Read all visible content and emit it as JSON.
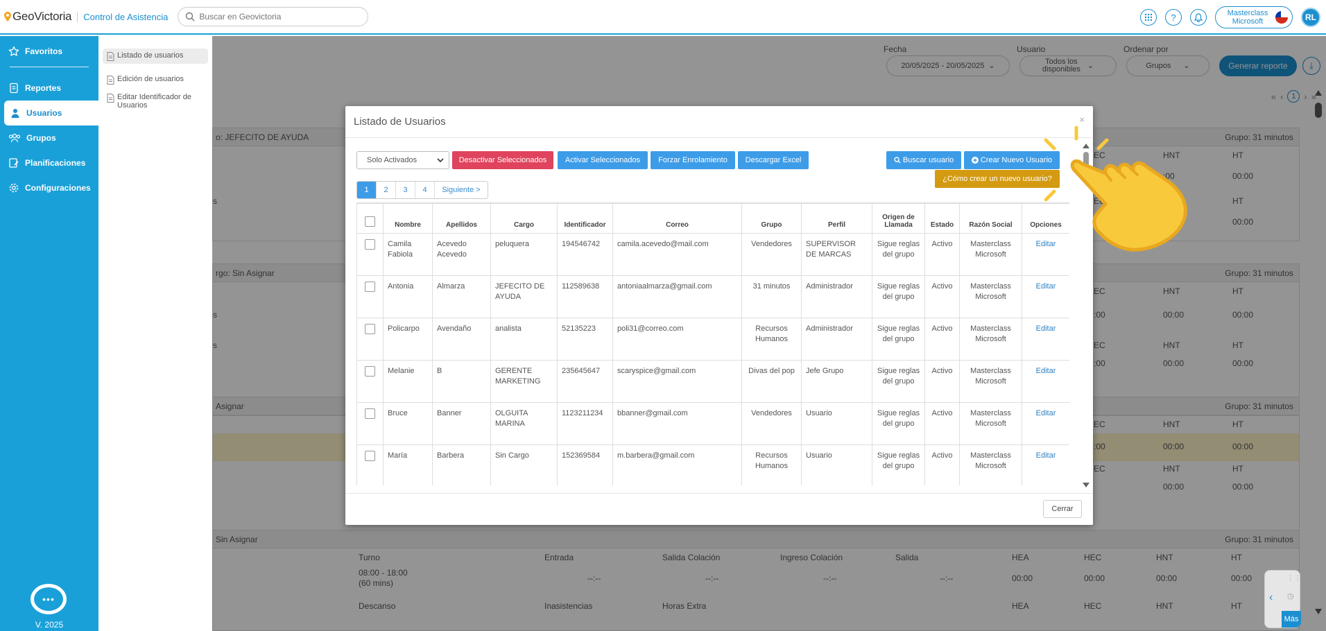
{
  "header": {
    "logo_text": "GeoVictoria",
    "app_name": "Control de Asistencia",
    "search_placeholder": "Buscar en Geovictoria",
    "company_line1": "Masterclass",
    "company_line2": "Microsoft",
    "avatar_initials": "RL"
  },
  "sidebar": {
    "items": [
      {
        "label": "Favoritos",
        "icon": "star-icon"
      },
      {
        "label": "Reportes",
        "icon": "report-icon"
      },
      {
        "label": "Usuarios",
        "icon": "user-icon"
      },
      {
        "label": "Grupos",
        "icon": "group-icon"
      },
      {
        "label": "Planificaciones",
        "icon": "plan-icon"
      },
      {
        "label": "Configuraciones",
        "icon": "gear-icon"
      }
    ],
    "active": "Usuarios",
    "version": "V. 2025"
  },
  "submenu": {
    "items": [
      "Listado de usuarios",
      "Edición de usuarios",
      "Editar Identificador de Usuarios"
    ]
  },
  "background": {
    "filters": {
      "fecha_label": "Fecha",
      "fecha_value": "20/05/2025 - 20/05/2025",
      "usuario_label": "Usuario",
      "usuario_value_line1": "Todos los",
      "usuario_value_line2": "disponibles",
      "ordenar_label": "Ordenar por",
      "ordenar_value": "Grupos",
      "generate_button": "Generar reporte"
    },
    "pager_current": "1",
    "sections": [
      {
        "title": "o: JEFECITO DE AYUDA",
        "group": "Grupo: 31 minutos"
      },
      {
        "title": "rgo: Sin Asignar",
        "group": "Grupo: 31 minutos"
      },
      {
        "title": "Asignar",
        "group": "Grupo: 31 minutos"
      },
      {
        "title": "Sin Asignar",
        "group": "Grupo: 31 minutos"
      }
    ],
    "col_heads": {
      "hea": "HEA",
      "hec": "HEC",
      "hnt": "HNT",
      "ht": "HT",
      "hec_cut": "EC",
      "turno": "Turno",
      "entrada": "Entrada",
      "salida_colacion": "Salida Colación",
      "ingreso_colacion": "Ingreso Colación",
      "salida": "Salida",
      "descanso": "Descanso",
      "inasistencias": "Inasistencias",
      "horas_extra": "Horas Extra"
    },
    "zero": "00:00",
    "zero_cut": ":00",
    "dash": "--:--",
    "s_cut": "s",
    "turno_value_line1": "08:00 - 18:00",
    "turno_value_line2": "(60 mins)",
    "widget_label": "Más"
  },
  "modal": {
    "title": "Listado de Usuarios",
    "close": "×",
    "filter_select": "Solo Activados",
    "buttons": {
      "deactivate": "Desactivar Seleccionados",
      "activate": "Activar Seleccionados",
      "force_enroll": "Forzar Enrolamiento",
      "download_excel": "Descargar Excel",
      "search_user": "Buscar usuario",
      "create_user": "Crear Nuevo Usuario",
      "how_to_create": "¿Cómo crear un nuevo usuario?",
      "close": "Cerrar"
    },
    "pagination": [
      "1",
      "2",
      "3",
      "4",
      "Siguiente >"
    ],
    "columns": [
      "Nombre",
      "Apellidos",
      "Cargo",
      "Identificador",
      "Correo",
      "Grupo",
      "Perfil",
      "Origen de Llamada",
      "Estado",
      "Razón Social",
      "Opciones"
    ],
    "rows": [
      {
        "nombre": "Camila Fabiola",
        "apellidos": "Acevedo Acevedo",
        "cargo": "peluquera",
        "id": "194546742",
        "correo": "camila.acevedo@mail.com",
        "grupo": "Vendedores",
        "perfil": "SUPERVISOR DE MARCAS",
        "origen": "Sigue reglas del grupo",
        "estado": "Activo",
        "razon": "Masterclass Microsoft",
        "opcion": "Editar"
      },
      {
        "nombre": "Antonia",
        "apellidos": "Almarza",
        "cargo": "JEFECITO DE AYUDA",
        "id": "112589638",
        "correo": "antoniaalmarza@gmail.com",
        "grupo": "31 minutos",
        "perfil": "Administrador",
        "origen": "Sigue reglas del grupo",
        "estado": "Activo",
        "razon": "Masterclass Microsoft",
        "opcion": "Editar"
      },
      {
        "nombre": "Policarpo",
        "apellidos": "Avendaño",
        "cargo": "analista",
        "id": "52135223",
        "correo": "poli31@correo.com",
        "grupo": "Recursos Humanos",
        "perfil": "Administrador",
        "origen": "Sigue reglas del grupo",
        "estado": "Activo",
        "razon": "Masterclass Microsoft",
        "opcion": "Editar"
      },
      {
        "nombre": "Melanie",
        "apellidos": "B",
        "cargo": "GERENTE MARKETING",
        "id": "235645647",
        "correo": "scaryspice@gmail.com",
        "grupo": "Divas del pop",
        "perfil": "Jefe Grupo",
        "origen": "Sigue reglas del grupo",
        "estado": "Activo",
        "razon": "Masterclass Microsoft",
        "opcion": "Editar"
      },
      {
        "nombre": "Bruce",
        "apellidos": "Banner",
        "cargo": "OLGUITA MARINA",
        "id": "1123211234",
        "correo": "bbanner@gmail.com",
        "grupo": "Vendedores",
        "perfil": "Usuario",
        "origen": "Sigue reglas del grupo",
        "estado": "Activo",
        "razon": "Masterclass Microsoft",
        "opcion": "Editar"
      },
      {
        "nombre": "María",
        "apellidos": "Barbera",
        "cargo": "Sin Cargo",
        "id": "152369584",
        "correo": "m.barbera@gmail.com",
        "grupo": "Recursos Humanos",
        "perfil": "Usuario",
        "origen": "Sigue reglas del grupo",
        "estado": "Activo",
        "razon": "Masterclass Microsoft",
        "opcion": "Editar"
      }
    ]
  },
  "colors": {
    "primary": "#1aa0d8",
    "danger": "#e0435d",
    "button_blue": "#3d9ce8",
    "gold": "#d49a11",
    "hand": "#f9c93c"
  }
}
